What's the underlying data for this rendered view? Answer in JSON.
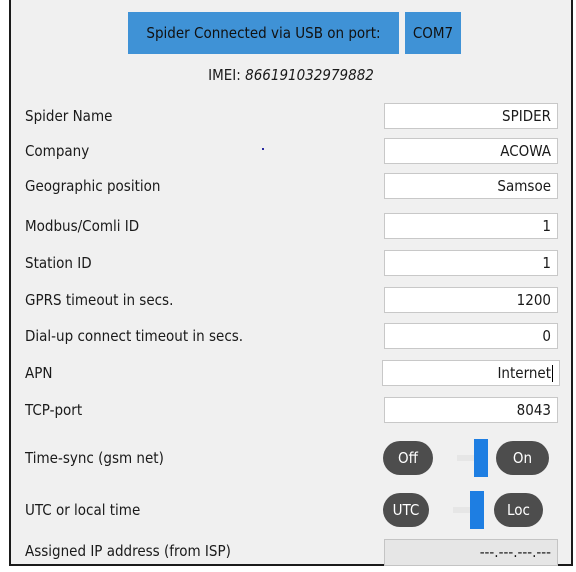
{
  "connection": {
    "status_label": "Spider Connected via USB on port:",
    "port": "COM7"
  },
  "imei": {
    "label": "IMEI:",
    "value": "866191032979882"
  },
  "fields": [
    {
      "label": "Spider Name",
      "value": "SPIDER"
    },
    {
      "label": "Company",
      "value": "ACOWA"
    },
    {
      "label": "Geographic position",
      "value": "Samsoe"
    },
    {
      "label": "Modbus/Comli ID",
      "value": "1"
    },
    {
      "label": "Station ID",
      "value": "1"
    },
    {
      "label": "GPRS timeout in secs.",
      "value": "1200"
    },
    {
      "label": "Dial-up connect timeout in secs.",
      "value": "0"
    },
    {
      "label": "APN",
      "value": "Internet"
    },
    {
      "label": "TCP-port",
      "value": "8043"
    }
  ],
  "time_sync": {
    "label": "Time-sync (gsm net)",
    "off_label": "Off",
    "on_label": "On",
    "state": "on"
  },
  "time_mode": {
    "label": "UTC or local time",
    "utc_label": "UTC",
    "local_label": "Loc",
    "state": "local"
  },
  "assigned_ip": {
    "label": "Assigned IP address (from ISP)",
    "value": "---.---.---.---"
  },
  "colors": {
    "accent": "#3f92d6",
    "toggle_knob": "#1e7ee2",
    "pill": "#4d4d4d",
    "frame_bg": "#f0f0f0"
  }
}
